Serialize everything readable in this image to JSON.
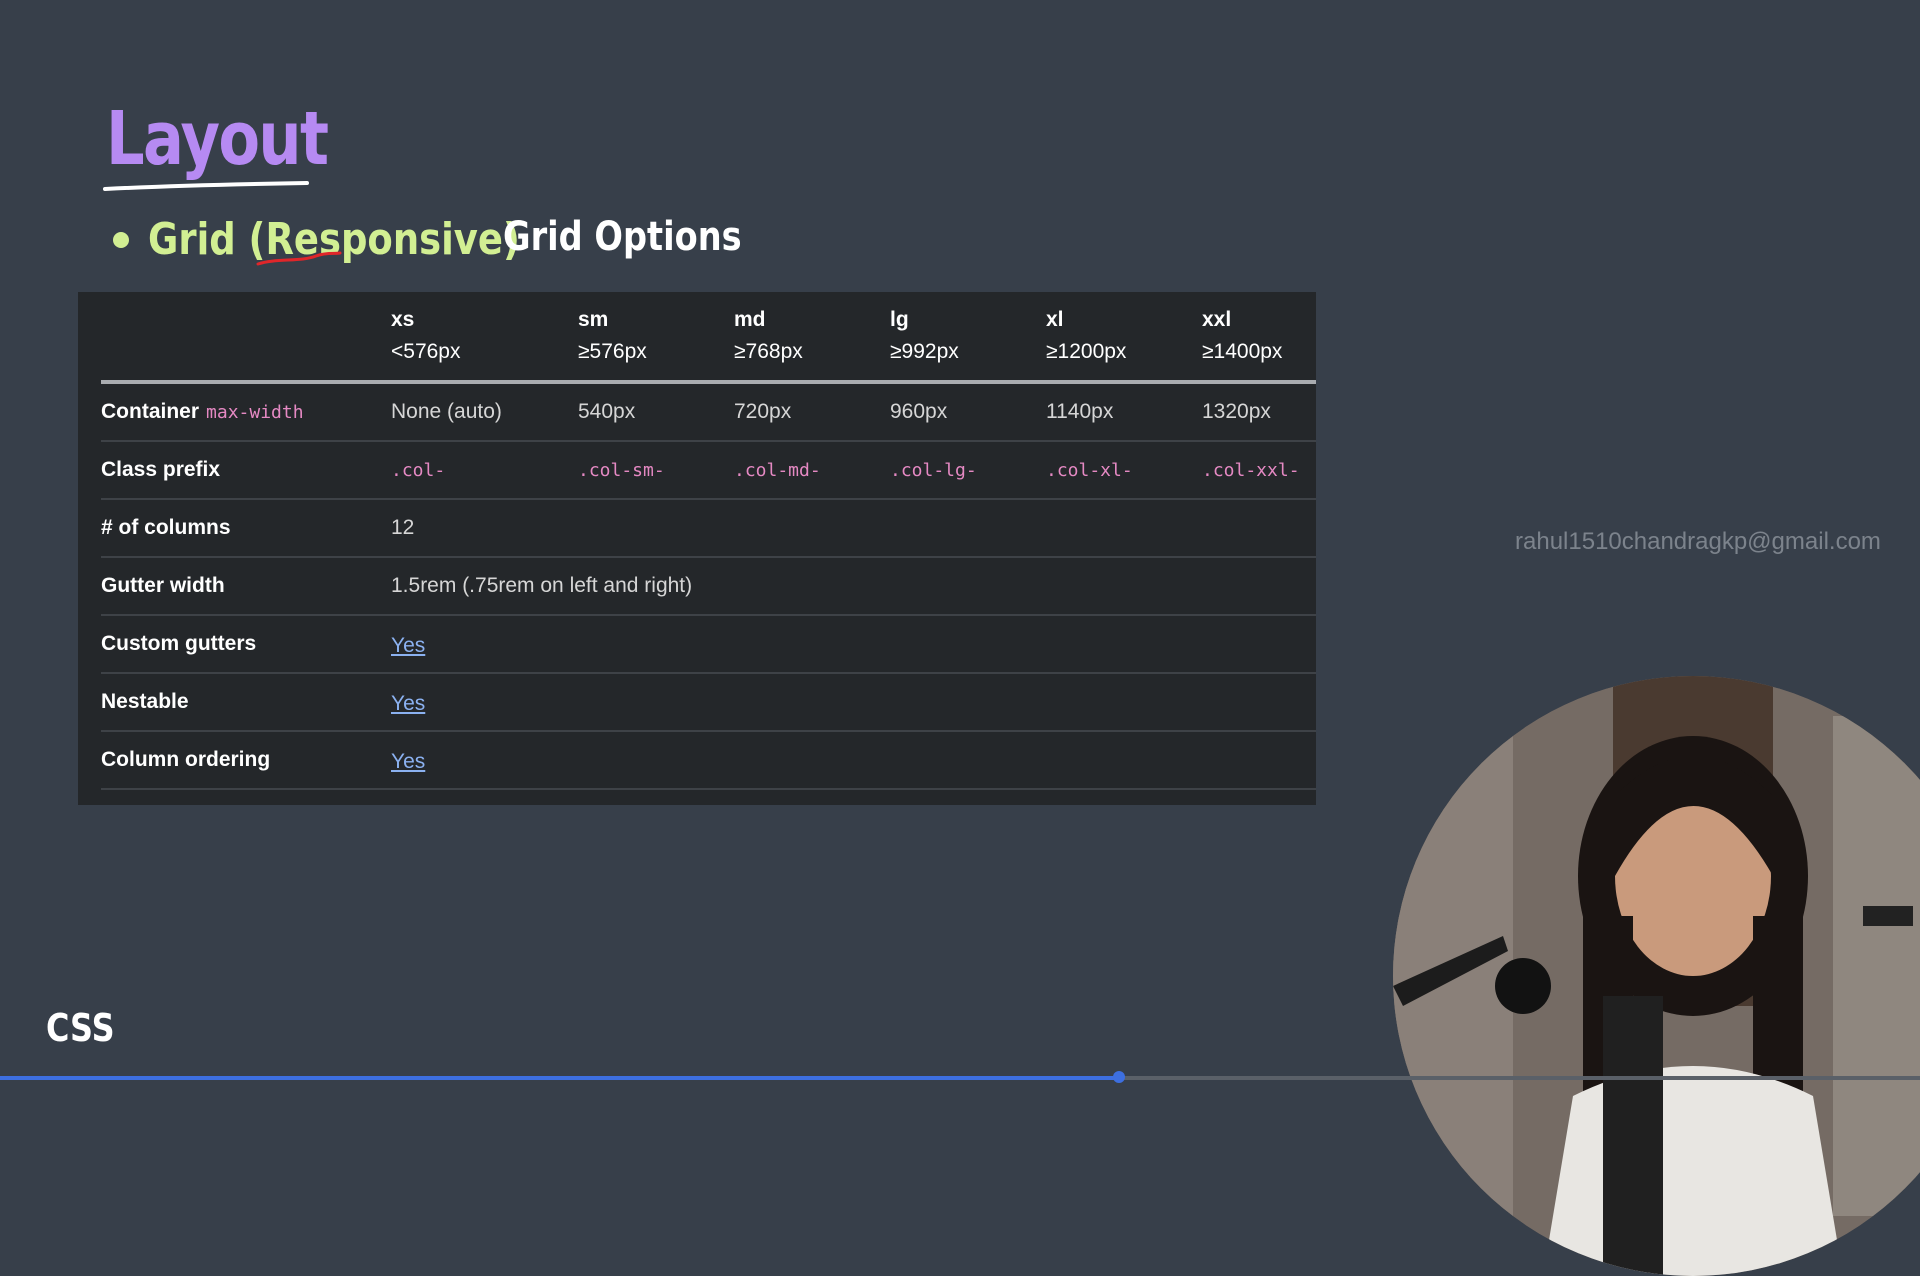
{
  "slide": {
    "title": "Layout",
    "bullet": "Grid (Responsive)",
    "subtitle": "Grid Options",
    "badge": "CSS",
    "watermark_email": "rahul1510chandragkp@gmail.com"
  },
  "table": {
    "breakpoints": [
      {
        "name": "xs",
        "range": "<576px"
      },
      {
        "name": "sm",
        "range": "≥576px"
      },
      {
        "name": "md",
        "range": "≥768px"
      },
      {
        "name": "lg",
        "range": "≥992px"
      },
      {
        "name": "xl",
        "range": "≥1200px"
      },
      {
        "name": "xxl",
        "range": "≥1400px"
      }
    ],
    "container": {
      "label": "Container",
      "code": "max-width",
      "values": [
        "None (auto)",
        "540px",
        "720px",
        "960px",
        "1140px",
        "1320px"
      ]
    },
    "class_prefix": {
      "label": "Class prefix",
      "values": [
        ".col-",
        ".col-sm-",
        ".col-md-",
        ".col-lg-",
        ".col-xl-",
        ".col-xxl-"
      ]
    },
    "columns": {
      "label": "# of columns",
      "value": "12"
    },
    "gutter_width": {
      "label": "Gutter width",
      "value": "1.5rem (.75rem on left and right)"
    },
    "custom_gutters": {
      "label": "Custom gutters",
      "value": "Yes"
    },
    "nestable": {
      "label": "Nestable",
      "value": "Yes"
    },
    "column_ordering": {
      "label": "Column ordering",
      "value": "Yes"
    }
  },
  "video": {
    "progress": 0.583
  },
  "colors": {
    "background": "#373f4a",
    "title": "#b68af2",
    "bullet": "#d2ef93",
    "code": "#e589c3",
    "link": "#8bb1f0",
    "progress": "#3d6fe0"
  }
}
